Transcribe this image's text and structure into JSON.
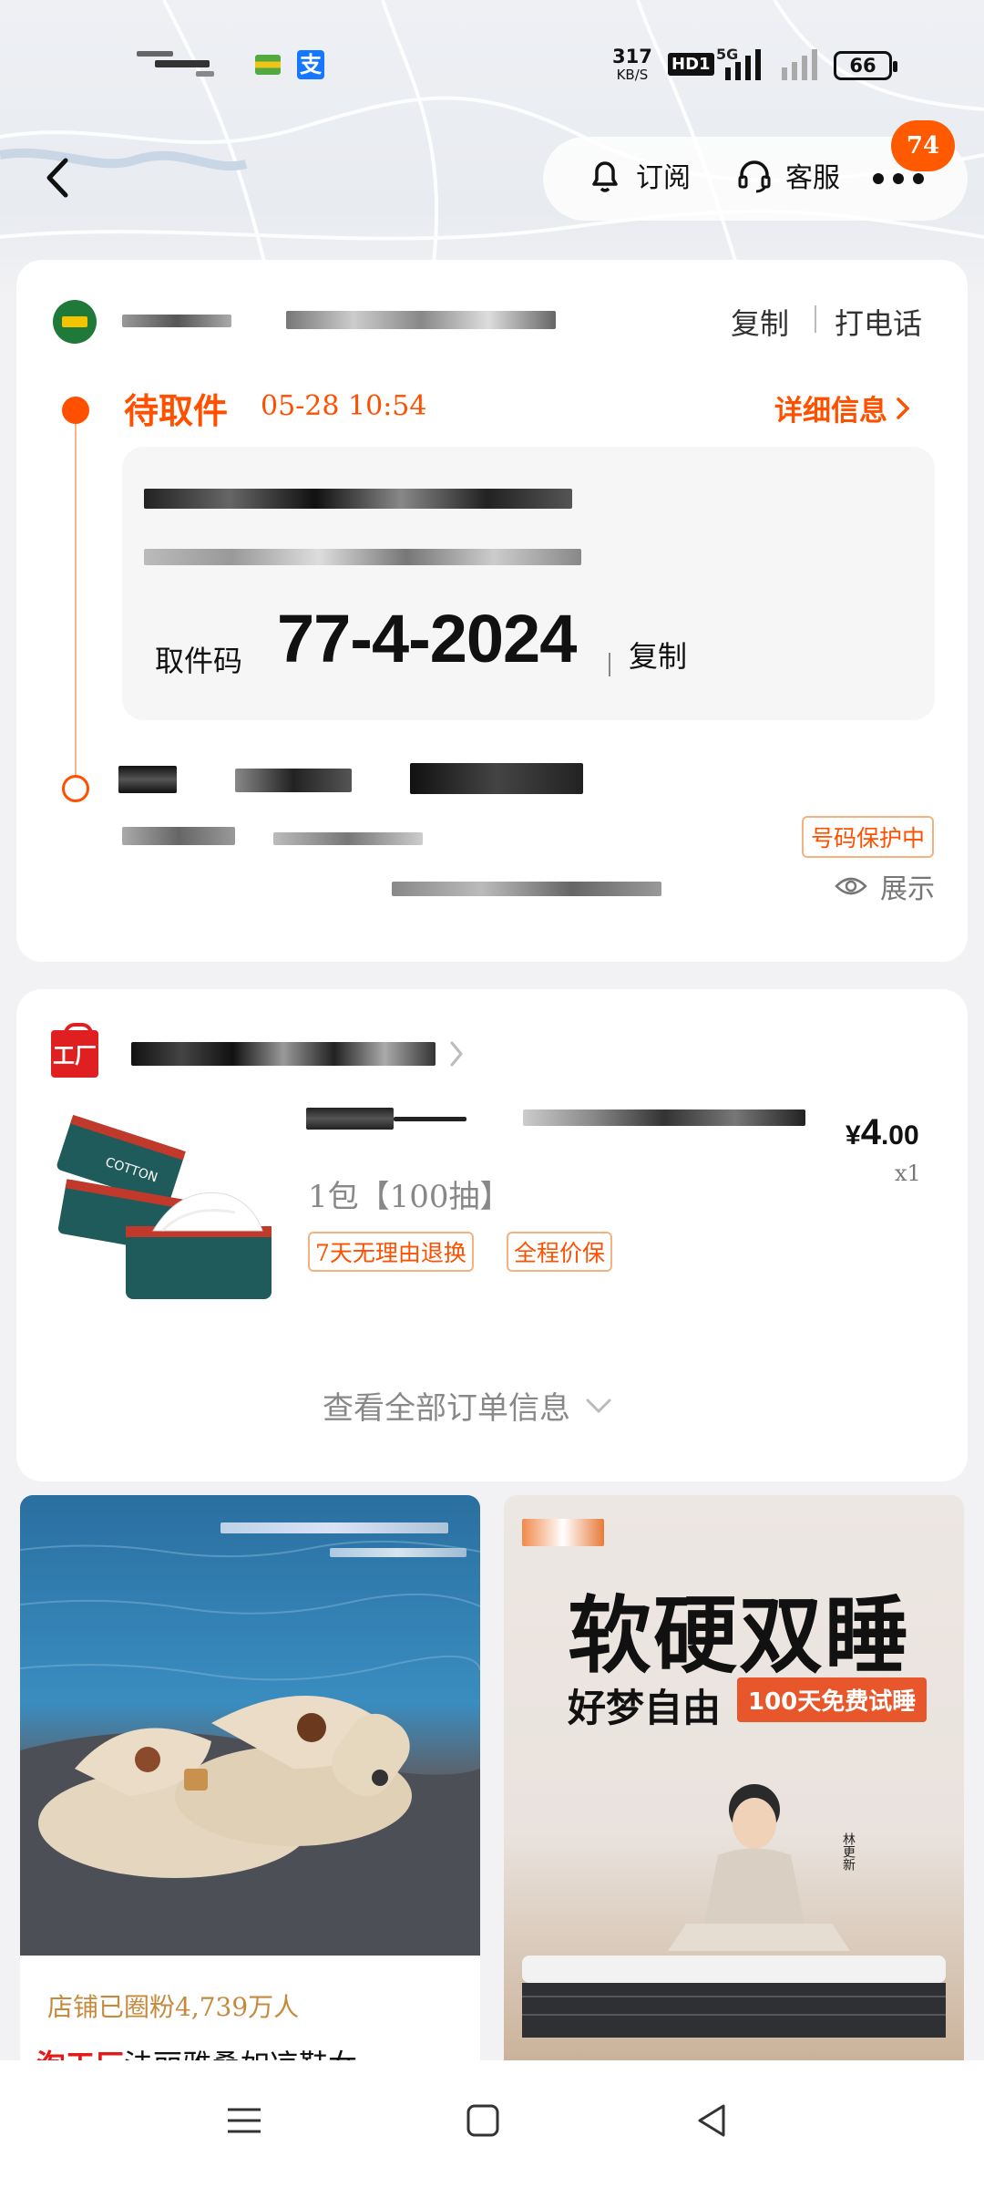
{
  "status_bar": {
    "net_speed_value": "317",
    "net_speed_unit": "KB/S",
    "hd_label": "HD1",
    "network_label": "5G",
    "battery": "66",
    "alipay_glyph": "支"
  },
  "header": {
    "subscribe_label": "订阅",
    "service_label": "客服",
    "badge_count": "74"
  },
  "delivery": {
    "copy_label": "复制",
    "call_label": "打电话",
    "status": "待取件",
    "status_time": "05-28 10:54",
    "detail_label": "详细信息",
    "pickup_code_label": "取件码",
    "pickup_code": "77-4-2024",
    "pickup_copy_label": "复制",
    "privacy_label": "号码保护中",
    "show_label": "展示"
  },
  "order": {
    "store_icon_text": "工厂",
    "price_currency": "¥",
    "price_int": "4",
    "price_dec": ".00",
    "quantity": "x1",
    "spec": "1包【100抽】",
    "tags": [
      "7天无理由退换",
      "全程价保"
    ],
    "view_all_label": "查看全部订单信息"
  },
  "feed": {
    "card1": {
      "fans_text": "店铺已圈粉4,739万人",
      "title_brand": "淘工厂",
      "title_text": "法丽雅桑如凉鞋女"
    },
    "card2": {
      "headline": "软硬双睡",
      "subline": "好梦自由",
      "promo": "100天免费试睡",
      "signature": "林更新"
    }
  },
  "product_packaging_text": "COTTON"
}
